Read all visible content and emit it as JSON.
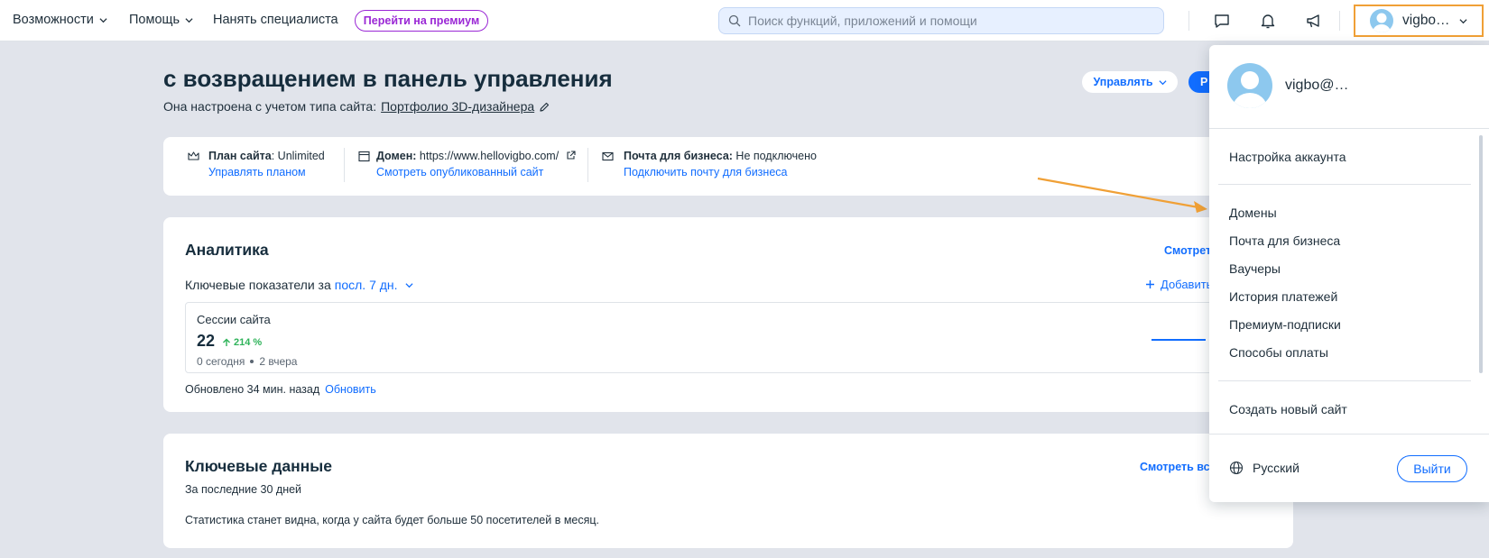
{
  "topbar": {
    "nav": [
      {
        "label": "Возможности",
        "has_dropdown": true
      },
      {
        "label": "Помощь",
        "has_dropdown": true
      },
      {
        "label": "Нанять специалиста",
        "has_dropdown": false
      }
    ],
    "premium_label": "Перейти на премиум",
    "search_placeholder": "Поиск функций, приложений и помощи",
    "icons": [
      "chat-icon",
      "bell-icon",
      "megaphone-icon"
    ],
    "account_name": "vigbo…"
  },
  "main": {
    "welcome_title": "с возвращением в панель управления",
    "subtitle_prefix": "Она настроена с учетом типа сайта:",
    "site_type_link": "Портфолио 3D-дизайнера",
    "manage_label": "Управлять",
    "blue_button_label": "Р",
    "info": {
      "plan_label": "План сайта",
      "plan_value": ": Unlimited",
      "plan_link": "Управлять планом",
      "domain_label": "Домен:",
      "domain_value": " https://www.hellovigbo.com/",
      "domain_link": "Смотреть опубликованный сайт",
      "mail_label": "Почта для бизнеса:",
      "mail_value": " Не подключено",
      "mail_link": "Подключить почту для бизнеса"
    },
    "analytics": {
      "title": "Аналитика",
      "see_link": "Смотреть",
      "kpi_prefix": "Ключевые показатели за",
      "period": "посл. 7 дн.",
      "add_label": "Добавить",
      "session_label": "Сессии сайта",
      "session_value": "22",
      "session_delta": "214 %",
      "today": "0 сегодня",
      "yesterday": "2 вчера",
      "updated": "Обновлено 34 мин. назад",
      "refresh": "Обновить"
    },
    "key_data": {
      "title": "Ключевые данные",
      "see_all": "Смотреть всю",
      "period": "За последние 30 дней",
      "note": "Статистика станет видна, когда у сайта будет больше 50 посетителей в месяц."
    }
  },
  "dropdown": {
    "user": "vigbo@…",
    "items_group1": [
      "Настройка аккаунта"
    ],
    "items_group2": [
      "Домены",
      "Почта для бизнеса",
      "Ваучеры",
      "История платежей",
      "Премиум-подписки",
      "Способы оплаты"
    ],
    "items_group3": [
      "Создать новый сайт"
    ],
    "language": "Русский",
    "logout": "Выйти"
  },
  "colors": {
    "accent": "#116dff",
    "premium": "#9a27d5",
    "highlight": "#f0a036",
    "positive": "#2fb35a",
    "background": "#e1e4eb"
  }
}
